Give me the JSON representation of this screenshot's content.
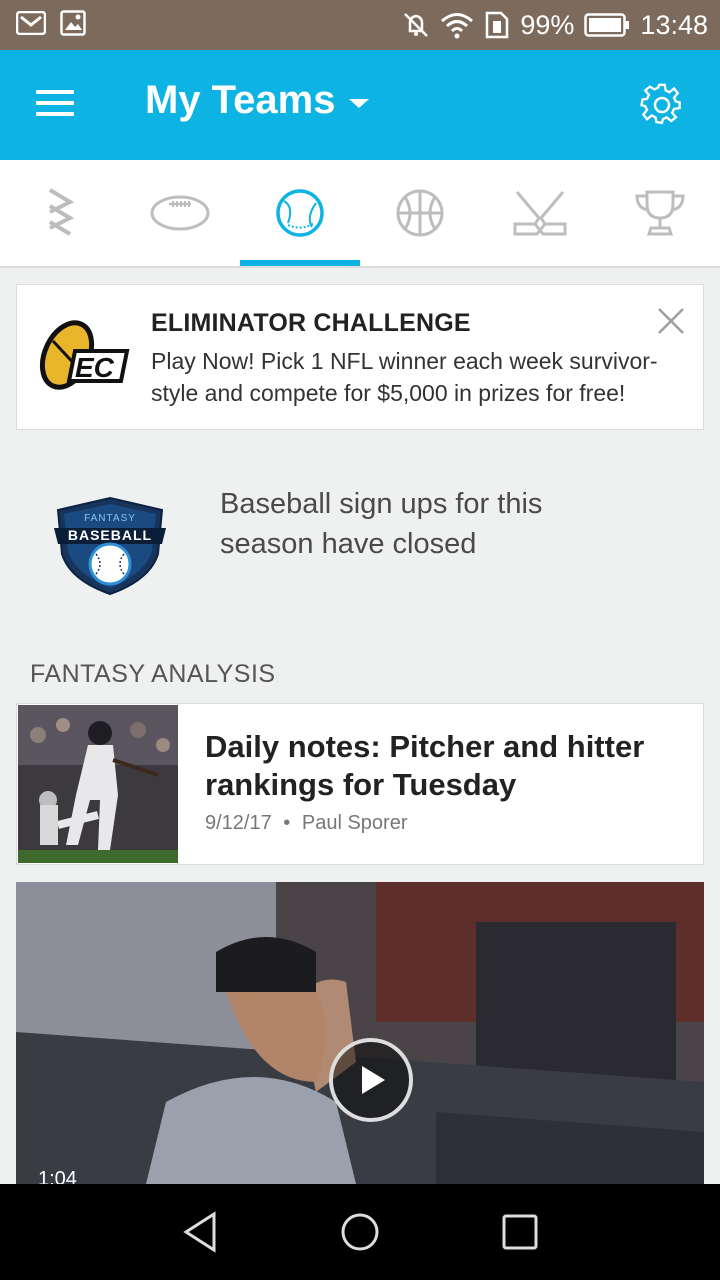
{
  "status_bar": {
    "battery": "99%",
    "time": "13:48",
    "icons": [
      "gmail-icon",
      "gallery-icon",
      "mute-icon",
      "wifi-icon",
      "sim-icon",
      "battery-icon"
    ]
  },
  "app_bar": {
    "title": "My Teams",
    "accent_color": "#0db4e3"
  },
  "sport_tabs": [
    {
      "name": "all-sports",
      "icon": "all-sports-icon"
    },
    {
      "name": "football",
      "icon": "football-icon"
    },
    {
      "name": "baseball",
      "icon": "baseball-icon",
      "selected": true
    },
    {
      "name": "basketball",
      "icon": "basketball-icon"
    },
    {
      "name": "hockey",
      "icon": "hockey-icon"
    },
    {
      "name": "tournament",
      "icon": "trophy-icon"
    }
  ],
  "promo": {
    "title": "ELIMINATOR CHALLENGE",
    "body": "Play Now! Pick 1 NFL winner each week survivor-style and compete for $5,000 in prizes for free!",
    "logo_text": "EC"
  },
  "signup": {
    "message": "Baseball sign ups for this season have closed",
    "badge_top": "FANTASY",
    "badge_main": "BASEBALL"
  },
  "section": {
    "title": "FANTASY ANALYSIS"
  },
  "article": {
    "title": "Daily notes: Pitcher and hitter rankings for Tuesday",
    "date": "9/12/17",
    "author": "Paul Sporer",
    "separator": "•"
  },
  "video": {
    "duration": "1:04"
  }
}
